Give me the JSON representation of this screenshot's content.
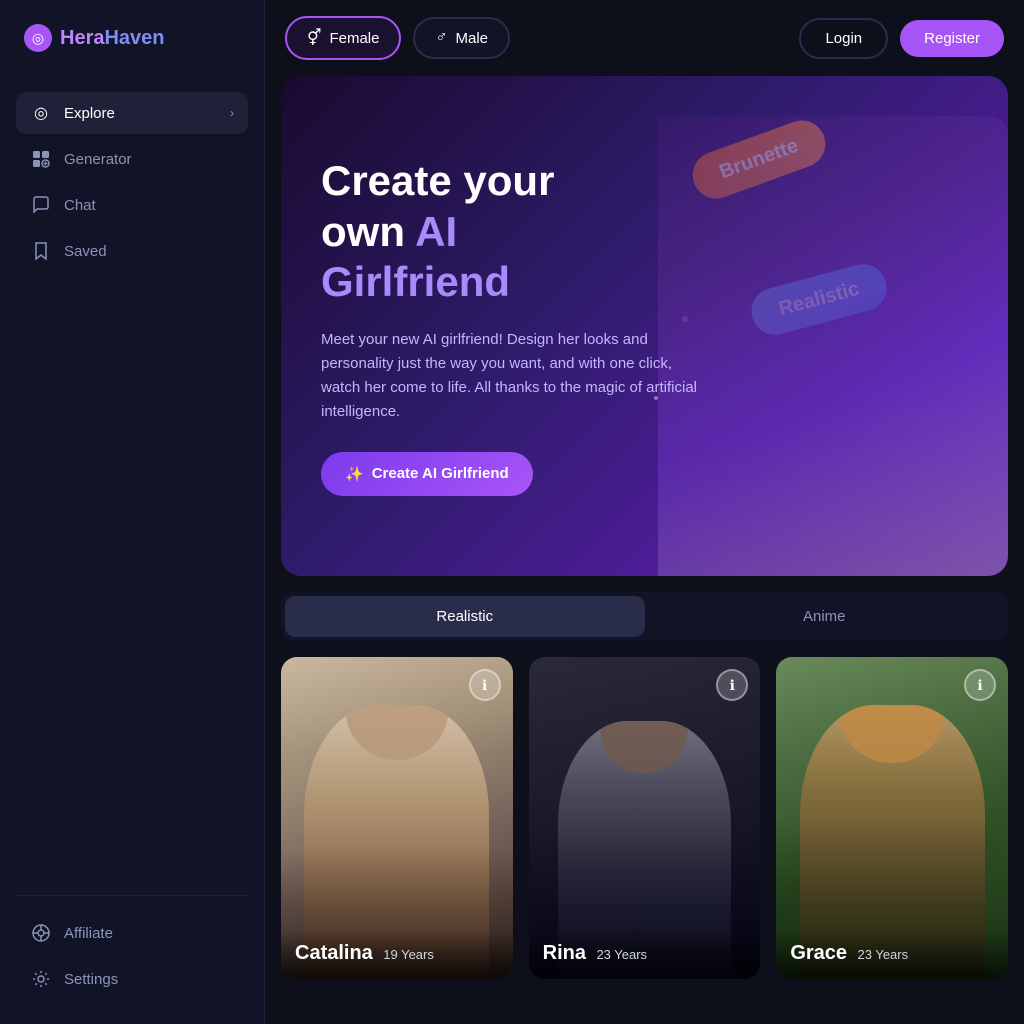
{
  "logo": {
    "icon": "◎",
    "part1": "Hera",
    "part2": "Haven"
  },
  "sidebar": {
    "nav_items": [
      {
        "id": "explore",
        "label": "Explore",
        "icon": "◎",
        "active": true,
        "has_chevron": true
      },
      {
        "id": "generator",
        "label": "Generator",
        "icon": "⊞",
        "active": false,
        "has_chevron": false
      },
      {
        "id": "chat",
        "label": "Chat",
        "icon": "💬",
        "active": false,
        "has_chevron": false
      },
      {
        "id": "saved",
        "label": "Saved",
        "icon": "🔖",
        "active": false,
        "has_chevron": false
      }
    ],
    "bottom_items": [
      {
        "id": "affiliate",
        "label": "Affiliate",
        "icon": "◈"
      },
      {
        "id": "settings",
        "label": "Settings",
        "icon": "⚙"
      }
    ]
  },
  "topbar": {
    "female_label": "Female",
    "male_label": "Male",
    "login_label": "Login",
    "register_label": "Register"
  },
  "hero": {
    "title_line1": "Create your",
    "title_line2": "own",
    "title_highlight": "AI",
    "title_line3": "Girlfriend",
    "description": "Meet your new AI girlfriend! Design her looks and personality just the way you want, and with one click, watch her come to life. All thanks to the magic of artificial intelligence.",
    "cta_label": "Create AI Girlfriend",
    "pill1": "Brunette",
    "pill2": "Realistic"
  },
  "style_tabs": [
    {
      "id": "realistic",
      "label": "Realistic",
      "active": true
    },
    {
      "id": "anime",
      "label": "Anime",
      "active": false
    }
  ],
  "cards": [
    {
      "id": "catalina",
      "name": "Catalina",
      "age": "19 Years"
    },
    {
      "id": "rina",
      "name": "Rina",
      "age": "23 Years"
    },
    {
      "id": "grace",
      "name": "Grace",
      "age": "23 Years"
    }
  ]
}
